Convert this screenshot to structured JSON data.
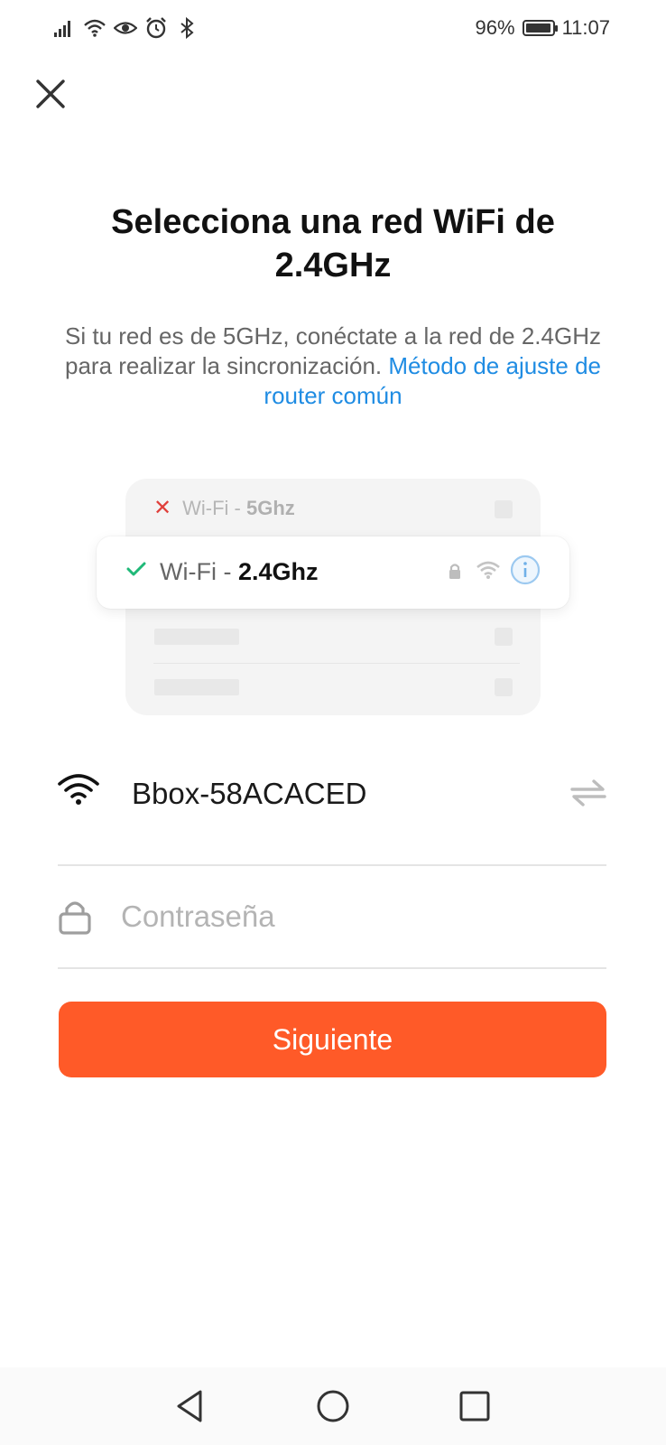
{
  "status_bar": {
    "battery_text": "96%",
    "battery_level": 0.96,
    "time": "11:07",
    "icons": [
      "signal-icon",
      "wifi-icon",
      "eye-icon",
      "alarm-icon",
      "bluetooth-icon"
    ]
  },
  "header": {
    "close_icon": "close-icon",
    "title": "Selecciona una red WiFi de 2.4GHz",
    "subtitle": "Si tu red es de 5GHz, conéctate a la red de 2.4GHz para realizar la sincronización.",
    "link": "Método de ajuste de router común"
  },
  "illustration": {
    "row_5ghz": {
      "prefix": "Wi-Fi - ",
      "band": "5Ghz"
    },
    "row_24ghz": {
      "prefix": "Wi-Fi - ",
      "band": "2.4Ghz"
    }
  },
  "form": {
    "network_name": "Bbox-58ACACED",
    "password_placeholder": "Contraseña",
    "password_value": "",
    "next_label": "Siguiente"
  },
  "colors": {
    "accent": "#ff5a28",
    "link": "#1f8ce3",
    "success": "#1fb978",
    "error": "#e0403b"
  }
}
